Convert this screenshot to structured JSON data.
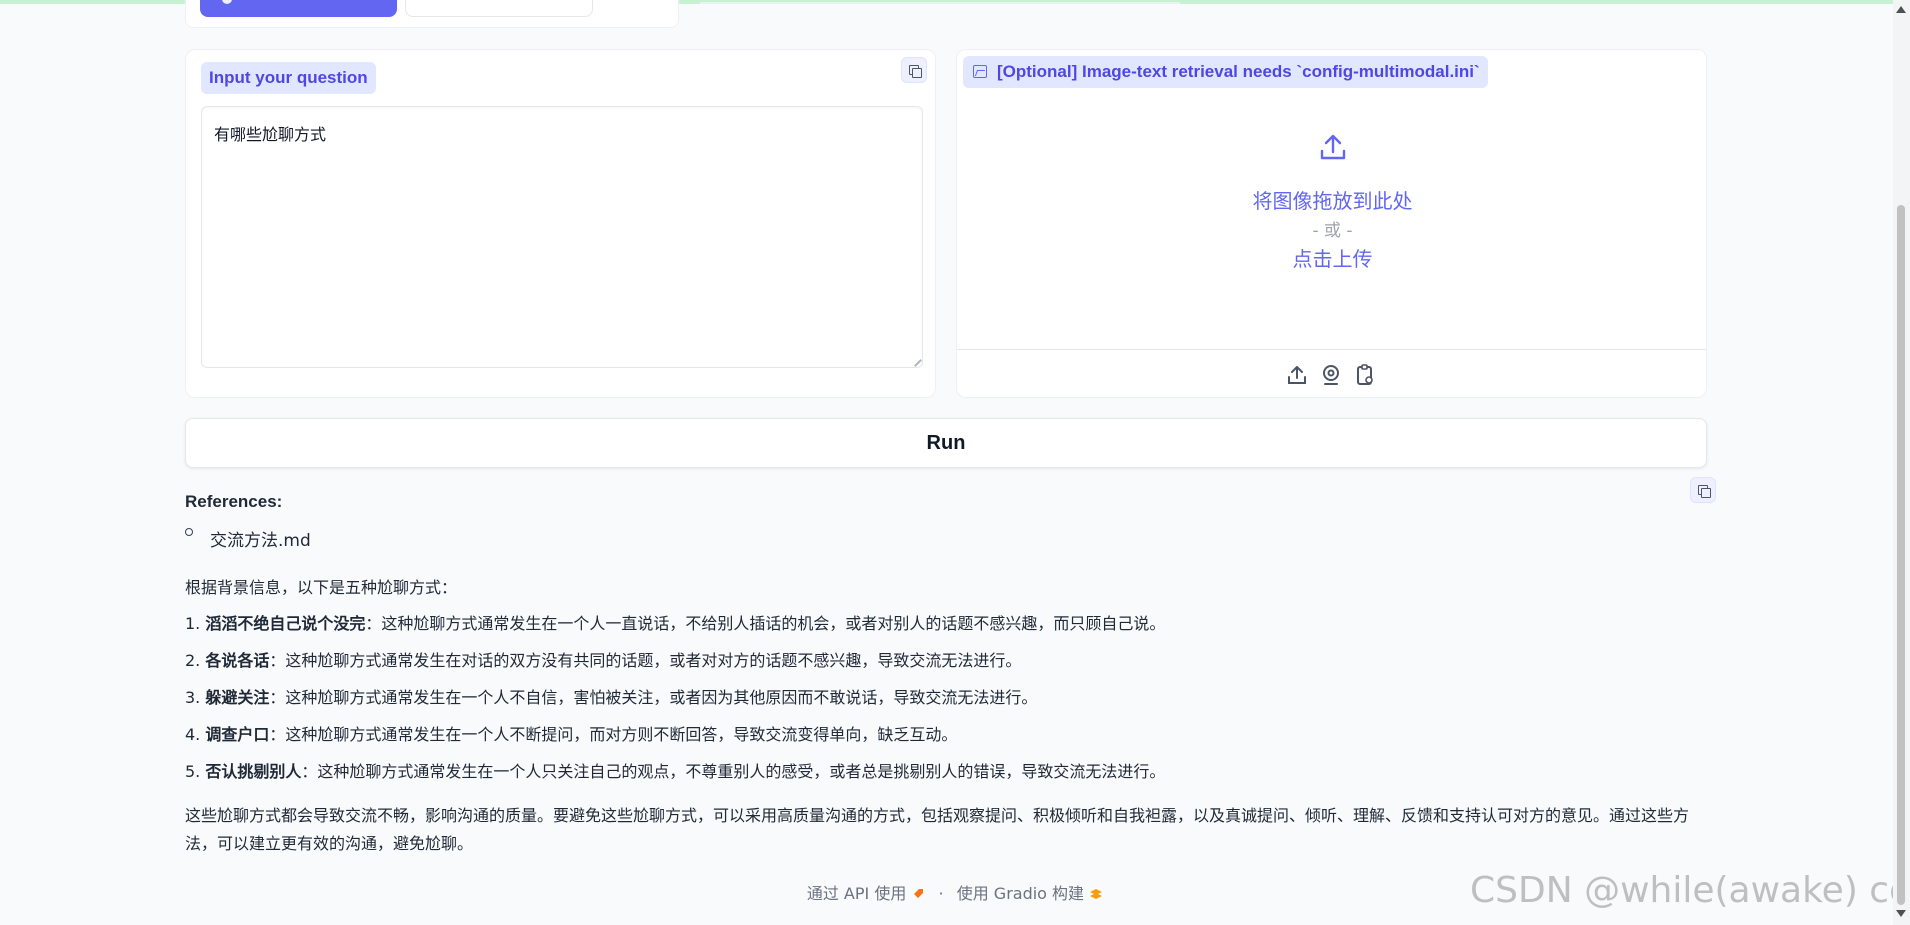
{
  "question_panel": {
    "label": "Input your question",
    "value": "有哪些尬聊方式"
  },
  "image_panel": {
    "label": "[Optional] Image-text retrieval needs `config-multimodal.ini`",
    "drop_text": "将图像拖放到此处",
    "or_text": "- 或 -",
    "click_text": "点击上传"
  },
  "run_button": {
    "label": "Run"
  },
  "answer": {
    "references_title": "References:",
    "references": [
      "交流方法.md"
    ],
    "intro": "根据背景信息，以下是五种尬聊方式：",
    "items": [
      {
        "num": "1.",
        "term": "滔滔不绝自己说个没完",
        "desc": "：这种尬聊方式通常发生在一个人一直说话，不给别人插话的机会，或者对别人的话题不感兴趣，而只顾自己说。"
      },
      {
        "num": "2.",
        "term": "各说各话",
        "desc": "：这种尬聊方式通常发生在对话的双方没有共同的话题，或者对对方的话题不感兴趣，导致交流无法进行。"
      },
      {
        "num": "3.",
        "term": "躲避关注",
        "desc": "：这种尬聊方式通常发生在一个人不自信，害怕被关注，或者因为其他原因而不敢说话，导致交流无法进行。"
      },
      {
        "num": "4.",
        "term": "调查户口",
        "desc": "：这种尬聊方式通常发生在一个人不断提问，而对方则不断回答，导致交流变得单向，缺乏互动。"
      },
      {
        "num": "5.",
        "term": "否认挑剔别人",
        "desc": "：这种尬聊方式通常发生在一个人只关注自己的观点，不尊重别人的感受，或者总是挑剔别人的错误，导致交流无法进行。"
      }
    ],
    "summary": "这些尬聊方式都会导致交流不畅，影响沟通的质量。要避免这些尬聊方式，可以采用高质量沟通的方式，包括观察提问、积极倾听和自我袒露，以及真诚提问、倾听、理解、反馈和支持认可对方的意见。通过这些方法，可以建立更有效的沟通，避免尬聊。"
  },
  "footer": {
    "api_link": "通过 API 使用",
    "separator": "·",
    "built_with": "使用 Gradio 构建"
  },
  "watermark": "CSDN @while(awake) code",
  "colors": {
    "accent": "#6366f1",
    "chip_bg": "#e0e7ff",
    "page_bg": "#f9fafb"
  }
}
